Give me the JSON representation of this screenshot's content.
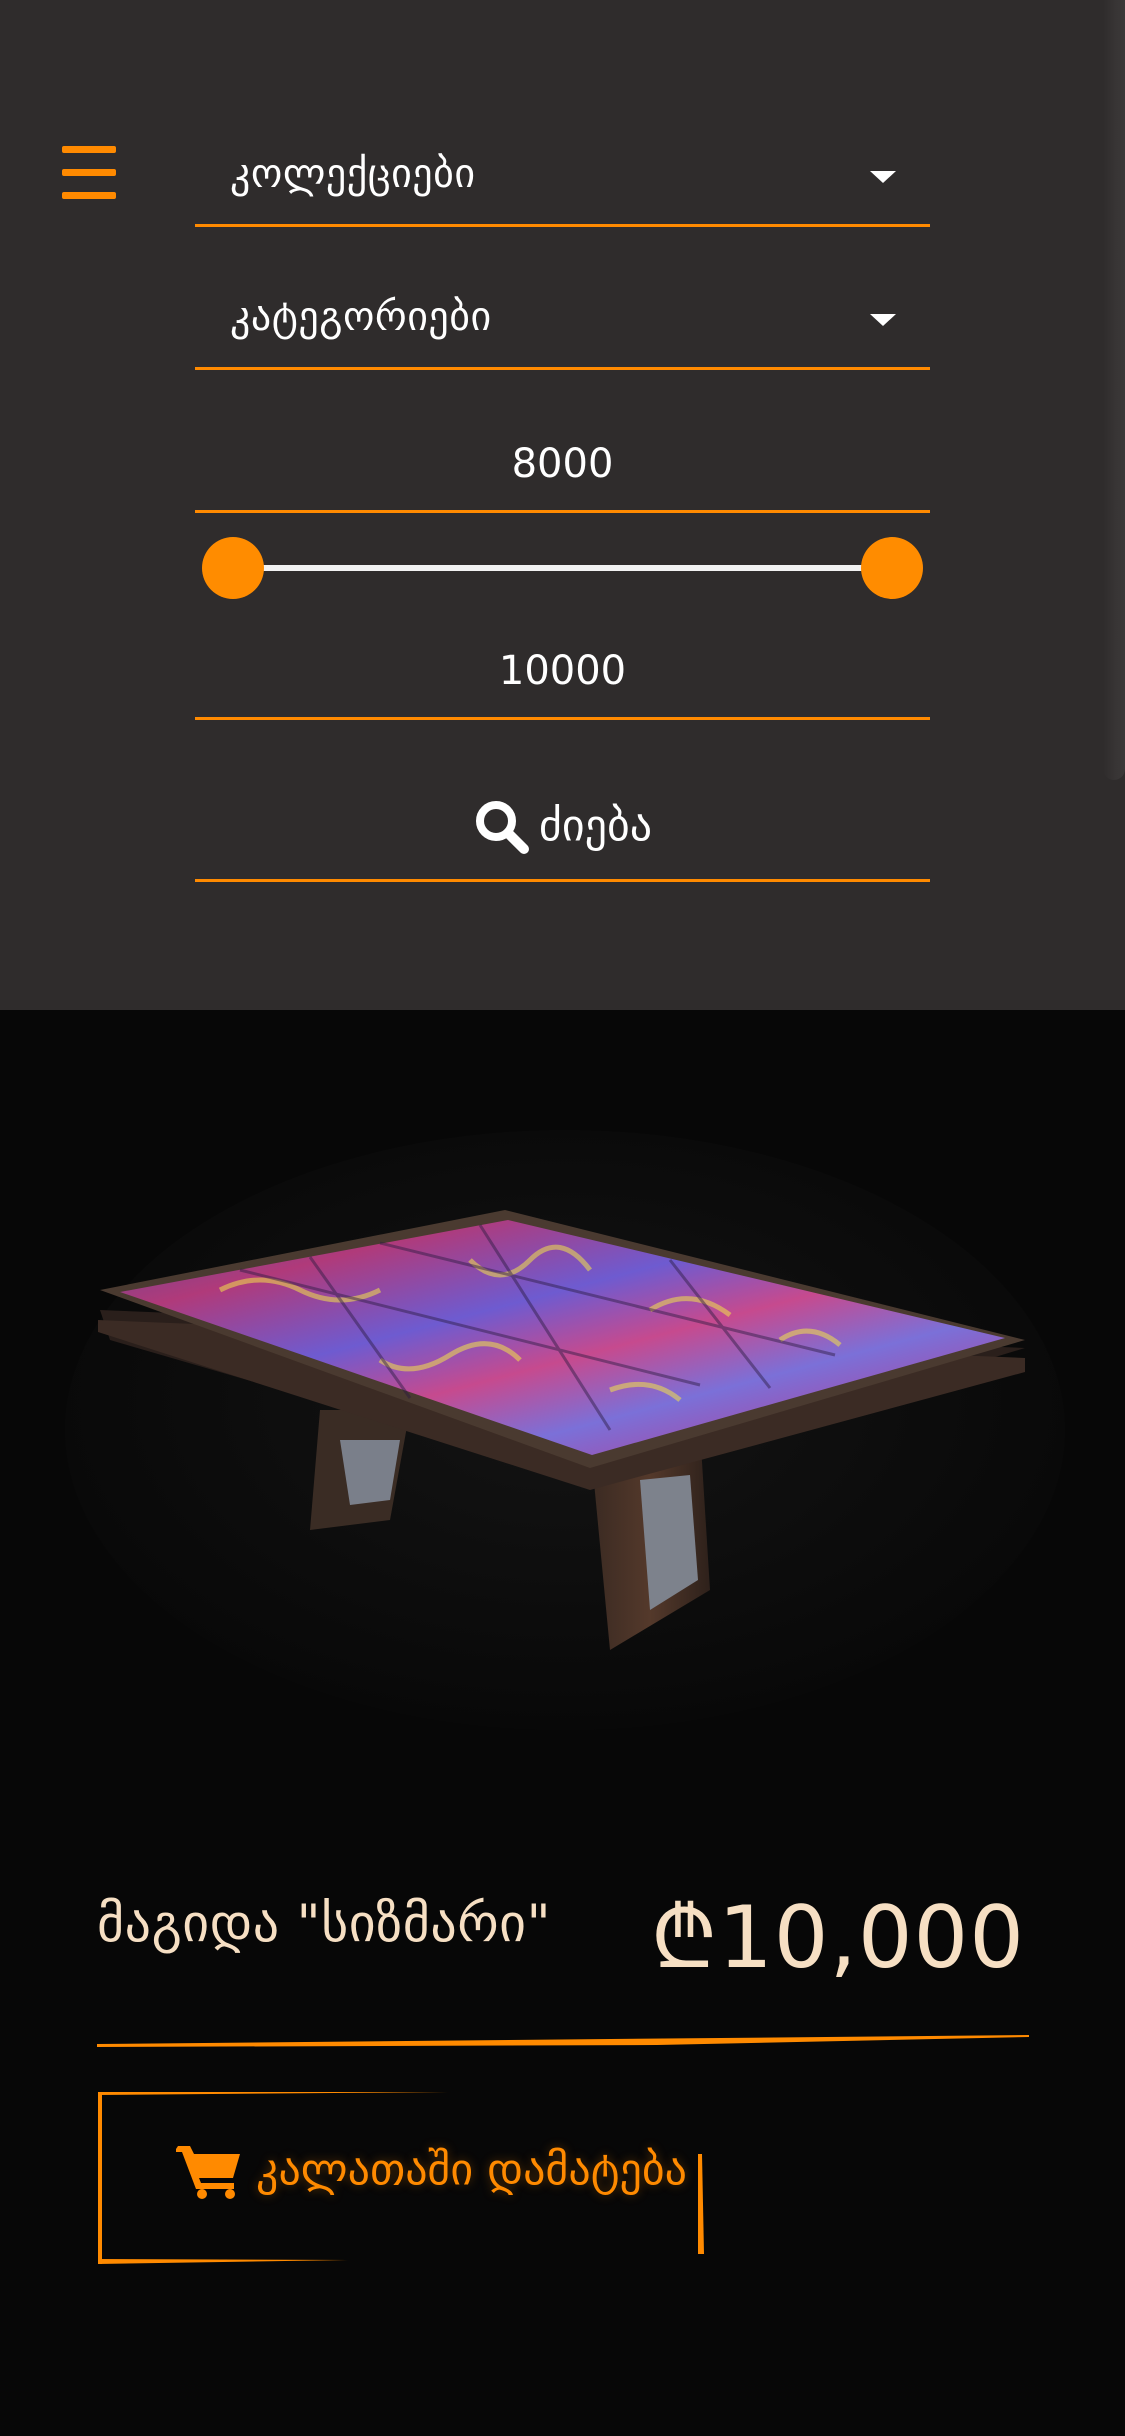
{
  "filters": {
    "menu_icon": "hamburger-menu-icon",
    "collections": {
      "label": "კოლექციები",
      "icon": "caret-down-icon"
    },
    "categories": {
      "label": "კატეგორიები",
      "icon": "caret-down-icon"
    },
    "price_min": "8000",
    "price_max": "10000",
    "price_range_slider": {
      "min_position": 0,
      "max_position": 1
    },
    "search": {
      "label": "ძიება",
      "icon": "search-icon"
    }
  },
  "product": {
    "name": "მაგიდა \"სიზმარი\"",
    "price": "₾10,000",
    "image_icon": "mosaic-table-image",
    "add_to_cart": {
      "label": "კალათაში დამატება",
      "icon": "cart-icon"
    }
  },
  "colors": {
    "accent": "#ff8a00",
    "panel_bg": "#2f2c2c",
    "page_bg": "#070707",
    "product_text": "#f6dfc3"
  }
}
